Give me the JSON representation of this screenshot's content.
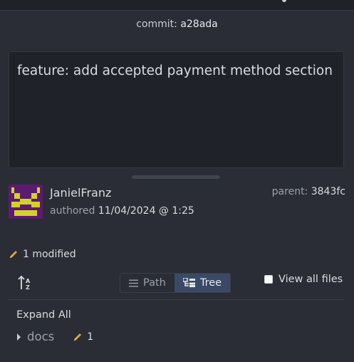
{
  "commit": {
    "label": "commit:",
    "sha": "a28ada"
  },
  "message": "feature: add accepted payment method section",
  "author": {
    "name": "JanielFranz",
    "authored_label": "authored",
    "date": "11/04/2024 @ 1:25",
    "avatar_icon": "identicon-avatar",
    "avatar_colors": {
      "background": "#5c1b6e",
      "foreground": "#d4d22a"
    }
  },
  "parent": {
    "label": "parent:",
    "sha": "3843fc"
  },
  "changes": {
    "modified_label": "1 modified",
    "icon": "pencil-icon",
    "icon_color": "#e8a33d"
  },
  "toolbar": {
    "sort_icon": "sort-alpha-icon",
    "path_label": "Path",
    "tree_label": "Tree",
    "active_view": "Tree",
    "view_all_label": "View all files",
    "view_all_checked": false
  },
  "file_tree": {
    "expand_all_label": "Expand All",
    "items": [
      {
        "name": "docs",
        "modified_count": "1"
      }
    ]
  },
  "colors": {
    "accent": "#3a4a66",
    "background": "#2a2d35",
    "panel": "#1f2228"
  }
}
